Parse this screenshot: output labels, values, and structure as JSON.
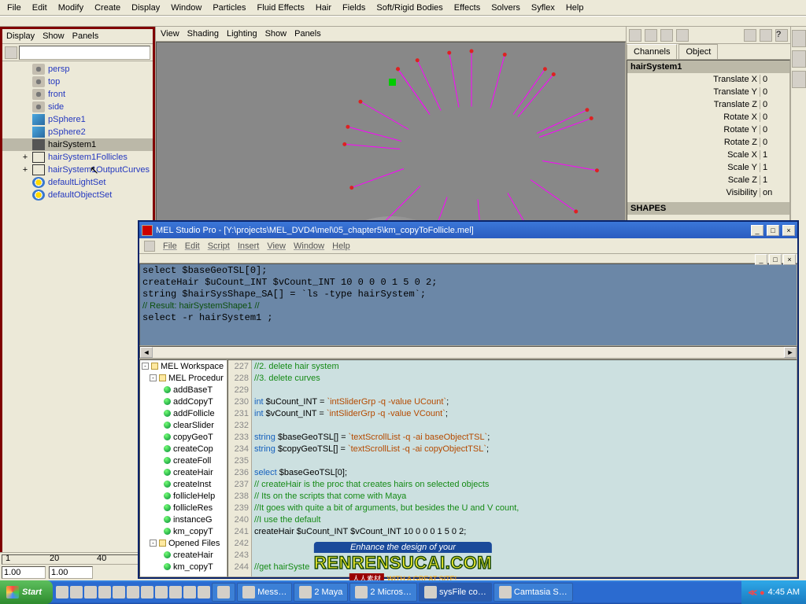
{
  "menubar": [
    "File",
    "Edit",
    "Modify",
    "Create",
    "Display",
    "Window",
    "Particles",
    "Fluid Effects",
    "Hair",
    "Fields",
    "Soft/Rigid Bodies",
    "Effects",
    "Solvers",
    "Syflex",
    "Help"
  ],
  "outliner": {
    "menu": [
      "Display",
      "Show",
      "Panels"
    ],
    "items": [
      {
        "icon": "cam",
        "label": "persp",
        "cls": "label"
      },
      {
        "icon": "cam",
        "label": "top",
        "cls": "label"
      },
      {
        "icon": "cam",
        "label": "front",
        "cls": "label"
      },
      {
        "icon": "cam",
        "label": "side",
        "cls": "label"
      },
      {
        "icon": "shape",
        "label": "pSphere1",
        "cls": "label"
      },
      {
        "icon": "shape",
        "label": "pSphere2",
        "cls": "label"
      },
      {
        "icon": "hair",
        "label": "hairSystem1",
        "cls": "label-k",
        "selected": true
      },
      {
        "icon": "crv",
        "label": "hairSystem1Follicles",
        "cls": "label",
        "expander": "+"
      },
      {
        "icon": "crv",
        "label": "hairSystem1OutputCurves",
        "cls": "label",
        "expander": "+"
      },
      {
        "icon": "set",
        "label": "defaultLightSet",
        "cls": "label"
      },
      {
        "icon": "set",
        "label": "defaultObjectSet",
        "cls": "label"
      }
    ]
  },
  "viewport_menu": [
    "View",
    "Shading",
    "Lighting",
    "Show",
    "Panels"
  ],
  "hair_angles": [
    10,
    35,
    60,
    85,
    110,
    135,
    160,
    185,
    210,
    235,
    260,
    285,
    310,
    335,
    -20,
    -55,
    -90,
    -125,
    195,
    245
  ],
  "channelbox": {
    "tabs": [
      "Channels",
      "Object"
    ],
    "node": "hairSystem1",
    "attrs": [
      {
        "nm": "Translate X",
        "val": "0"
      },
      {
        "nm": "Translate Y",
        "val": "0"
      },
      {
        "nm": "Translate Z",
        "val": "0"
      },
      {
        "nm": "Rotate X",
        "val": "0"
      },
      {
        "nm": "Rotate Y",
        "val": "0"
      },
      {
        "nm": "Rotate Z",
        "val": "0"
      },
      {
        "nm": "Scale X",
        "val": "1"
      },
      {
        "nm": "Scale Y",
        "val": "1"
      },
      {
        "nm": "Scale Z",
        "val": "1"
      },
      {
        "nm": "Visibility",
        "val": "on"
      }
    ],
    "shapes_label": "SHAPES"
  },
  "mel": {
    "title": "MEL Studio Pro - [Y:\\projects\\MEL_DVD4\\mel\\05_chapter5\\km_copyToFollicle.mel]",
    "menu": [
      "File",
      "Edit",
      "Script",
      "Insert",
      "View",
      "Window",
      "Help"
    ],
    "output": "select $baseGeoTSL[0];\ncreateHair $uCount_INT $vCount_INT 10 0 0 0 1 5 0 2;\nstring $hairSysShape_SA[] = `ls -type hairSystem`;\n// Result: hairSystemShape1 //\nselect -r hairSystem1 ;",
    "tree": {
      "root": "MEL Workspace",
      "proc": "MEL Procedur",
      "procs": [
        "addBaseT",
        "addCopyT",
        "addFollicle",
        "clearSlider",
        "copyGeoT",
        "createCop",
        "createFoll",
        "createHair",
        "createInst",
        "follicleHelp",
        "follicleRes",
        "instanceG",
        "km_copyT"
      ],
      "opened": "Opened Files",
      "files": [
        "createHair",
        "km_copyT"
      ]
    },
    "lines": [
      227,
      228,
      229,
      230,
      231,
      232,
      233,
      234,
      235,
      236,
      237,
      238,
      239,
      240,
      241,
      242,
      243,
      244
    ],
    "code_html": "<span class='cm'>//2. delete hair system</span>\n<span class='cm'>//3. delete curves</span>\n\n<span class='kw'>int</span> $uCount_INT = <span class='str'>`intSliderGrp -q -value UCount`</span>;\n<span class='kw'>int</span> $vCount_INT = <span class='str'>`intSliderGrp -q -value VCount`</span>;\n\n<span class='kw'>string</span> $baseGeoTSL[] = <span class='str'>`textScrollList -q -ai baseObjectTSL`</span>;\n<span class='kw'>string</span> $copyGeoTSL[] = <span class='str'>`textScrollList -q -ai copyObjectTSL`</span>;\n\n<span class='kw'>select</span> $baseGeoTSL[0];\n<span class='cm'>// createHair is the proc that creates hairs on selected objects</span>\n<span class='cm'>// Its on the scripts that come with Maya</span>\n<span class='cm'>//It goes with quite a bit of arguments, but besides the U and V count,</span>\n<span class='cm'>//I use the default</span>\ncreateHair $uCount_INT $vCount_INT 10 0 0 0 1 5 0 2;\n\n\n<span class='cm'>//get hairSyste</span>"
  },
  "timeline": {
    "ticks": [
      "1",
      "20",
      "40"
    ],
    "start": "1.00",
    "cur": "1.00"
  },
  "taskbar": {
    "start": "Start",
    "items": [
      {
        "label": "",
        "active": false
      },
      {
        "label": "Mess…",
        "active": false
      },
      {
        "label": "2 Maya",
        "active": false
      },
      {
        "label": "2 Micros…",
        "active": false
      },
      {
        "label": "sysFile co…",
        "active": true
      },
      {
        "label": "Camtasia S…",
        "active": false
      }
    ],
    "time": "4:45 AM"
  },
  "watermark": {
    "top": "Enhance the design of your",
    "main": "RENRENSUCAI.COM",
    "sub1": "人人素材",
    "sub2": "WITH A GREAT SITE!"
  }
}
